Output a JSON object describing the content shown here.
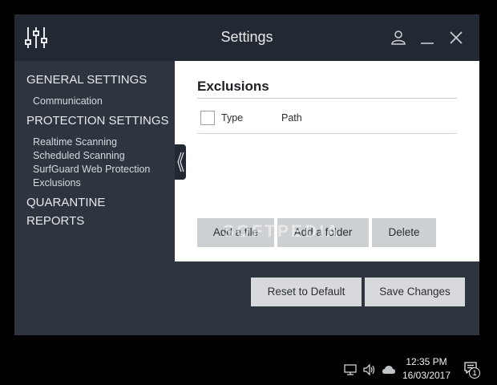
{
  "window": {
    "title": "Settings"
  },
  "sidebar": {
    "general_settings": "GENERAL SETTINGS",
    "communication": "Communication",
    "protection_settings": "PROTECTION SETTINGS",
    "realtime_scanning": "Realtime Scanning",
    "scheduled_scanning": "Scheduled Scanning",
    "surfguard": "SurfGuard Web Protection",
    "exclusions": "Exclusions",
    "quarantine": "QUARANTINE",
    "reports": "REPORTS"
  },
  "exclusions": {
    "title": "Exclusions",
    "columns": {
      "type": "Type",
      "path": "Path"
    },
    "add_file_label": "Add a file",
    "add_folder_label": "Add a folder",
    "delete_label": "Delete"
  },
  "watermark": "SOFTPEDIA",
  "footer": {
    "reset_label": "Reset to Default",
    "save_label": "Save Changes"
  },
  "taskbar": {
    "time": "12:35 PM",
    "date": "16/03/2017",
    "notification_count": "1"
  },
  "icons": [
    "sliders-icon",
    "user-icon",
    "minimize-icon",
    "close-icon",
    "chevron-left-icon",
    "network-icon",
    "volume-icon",
    "onedrive-cloud-icon",
    "notification-icon"
  ]
}
